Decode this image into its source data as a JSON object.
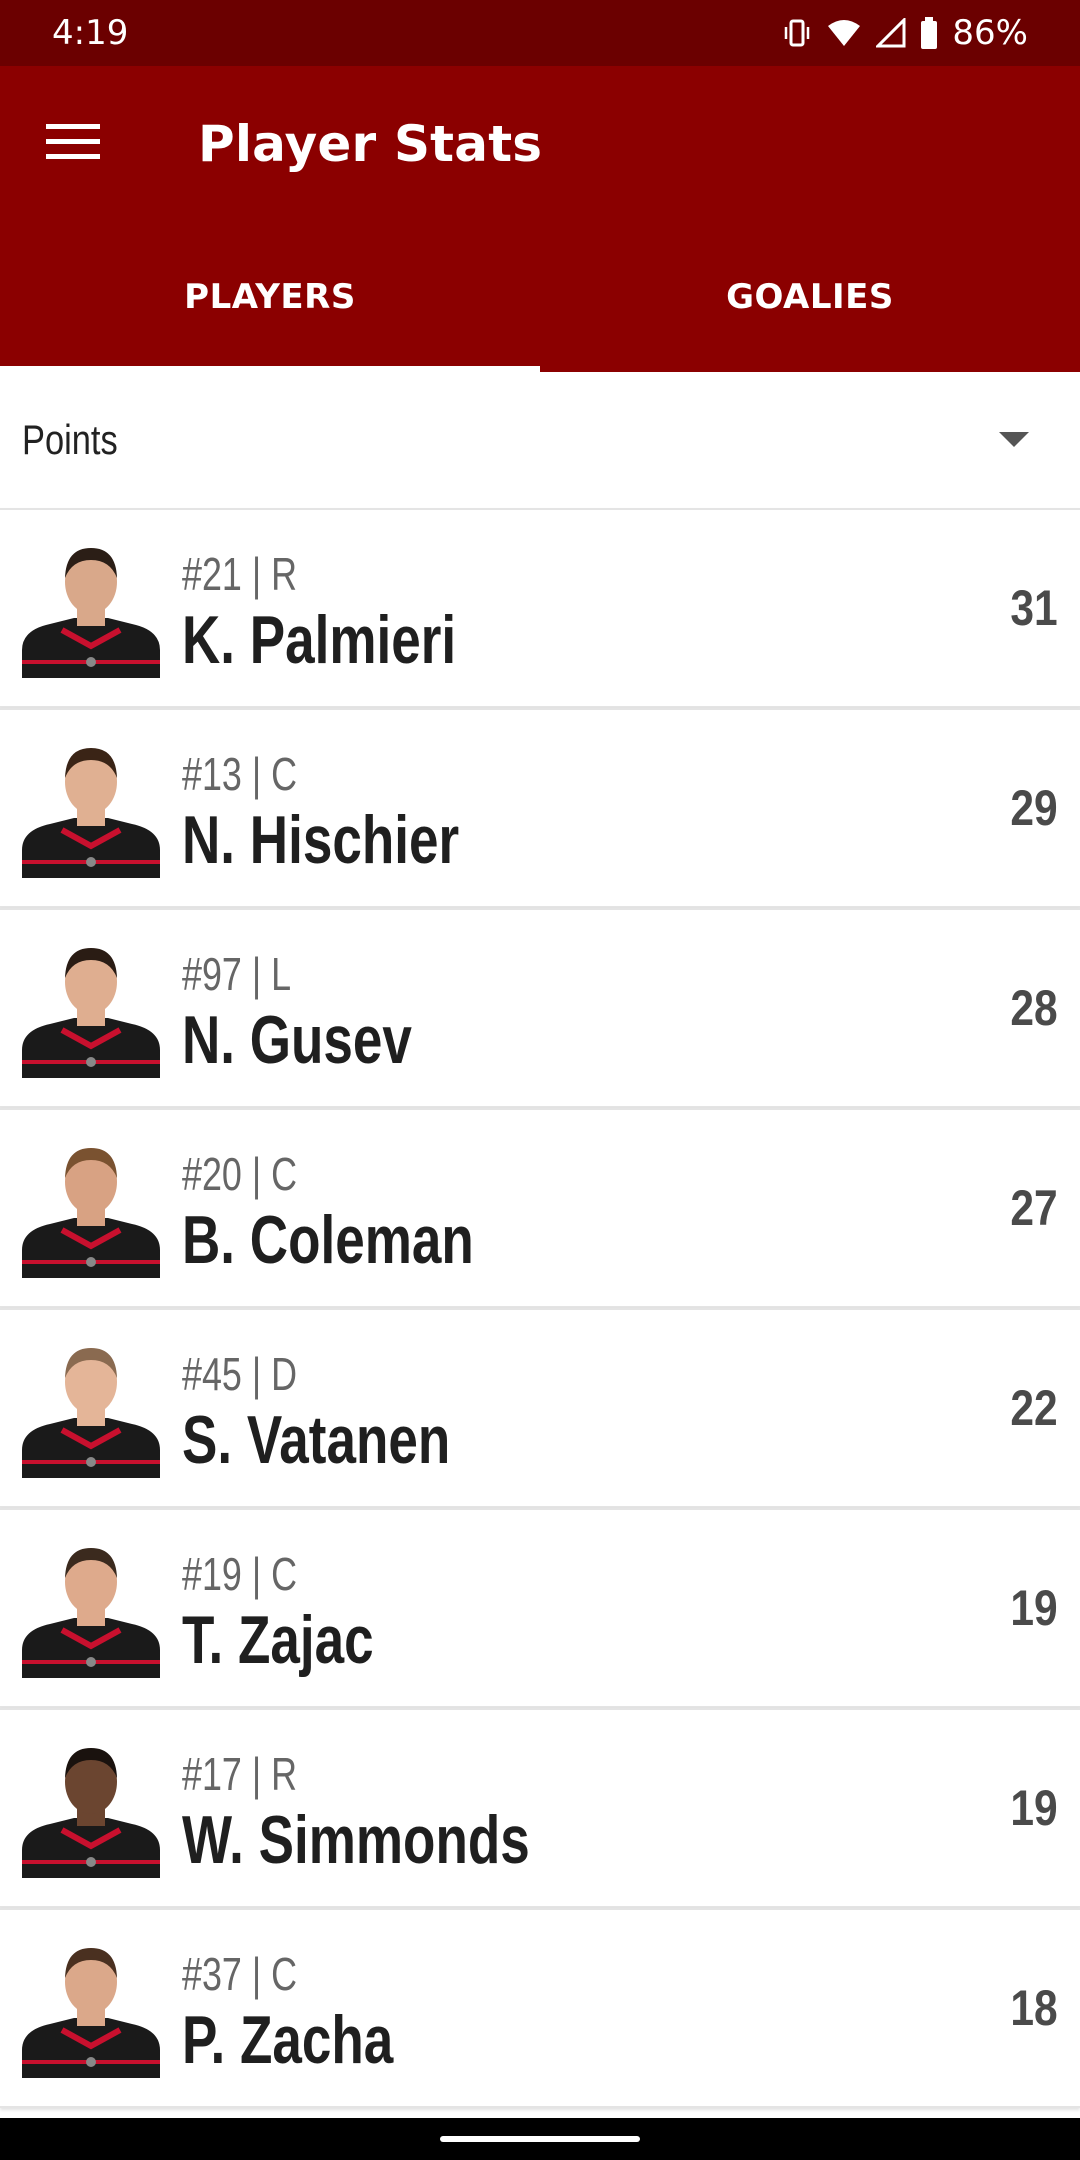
{
  "status_bar": {
    "time": "4:19",
    "battery_pct": "86%",
    "icons": [
      "vibrate-icon",
      "wifi-icon",
      "signal-icon",
      "battery-icon"
    ]
  },
  "app_bar": {
    "title": "Player Stats",
    "menu_icon": "hamburger-menu-icon"
  },
  "tabs": [
    {
      "label": "PLAYERS",
      "active": true
    },
    {
      "label": "GOALIES",
      "active": false
    }
  ],
  "sort": {
    "selected": "Points",
    "icon": "dropdown-arrow-icon"
  },
  "players": [
    {
      "meta": "#21 | R",
      "name": "K. Palmieri",
      "points": "31"
    },
    {
      "meta": "#13 | C",
      "name": "N. Hischier",
      "points": "29"
    },
    {
      "meta": "#97 | L",
      "name": "N. Gusev",
      "points": "28"
    },
    {
      "meta": "#20 | C",
      "name": "B. Coleman",
      "points": "27"
    },
    {
      "meta": "#45 | D",
      "name": "S. Vatanen",
      "points": "22"
    },
    {
      "meta": "#19 | C",
      "name": "T. Zajac",
      "points": "19"
    },
    {
      "meta": "#17 | R",
      "name": "W. Simmonds",
      "points": "19"
    },
    {
      "meta": "#37 | C",
      "name": "P. Zacha",
      "points": "18"
    }
  ],
  "colors": {
    "status_bar": "#6b0000",
    "app_bar": "#8b0000",
    "jersey_black": "#1a1a1a",
    "jersey_red": "#c8102e"
  }
}
